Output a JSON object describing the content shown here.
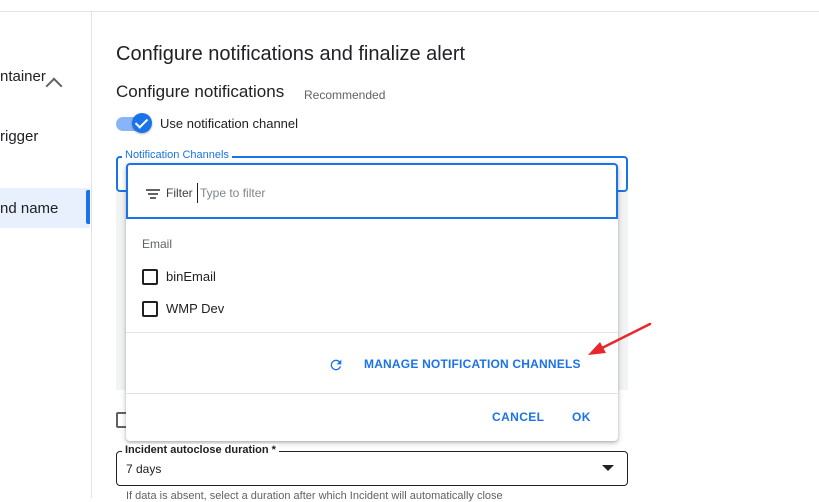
{
  "sidebar": {
    "items": [
      {
        "label": "ntainer"
      },
      {
        "label": "rigger"
      },
      {
        "label": "nd name"
      }
    ]
  },
  "page": {
    "title": "Configure notifications and finalize alert",
    "section_title": "Configure notifications",
    "section_tag": "Recommended",
    "toggle_label": "Use notification channel",
    "toggle_on": true
  },
  "notification_channels": {
    "label": "Notification Channels",
    "filter_label": "Filter",
    "filter_placeholder": "Type to filter",
    "group_label": "Email",
    "options": [
      {
        "label": "binEmail",
        "checked": false
      },
      {
        "label": "WMP Dev",
        "checked": false
      }
    ],
    "manage_label": "MANAGE NOTIFICATION CHANNELS",
    "cancel_label": "CANCEL",
    "ok_label": "OK"
  },
  "incident_autoclose": {
    "label": "Incident autoclose duration *",
    "value": "7 days",
    "helper": "If data is absent, select a duration after which Incident will automatically close"
  },
  "colors": {
    "accent": "#1a73e8",
    "annotation_arrow": "#e8262b"
  }
}
